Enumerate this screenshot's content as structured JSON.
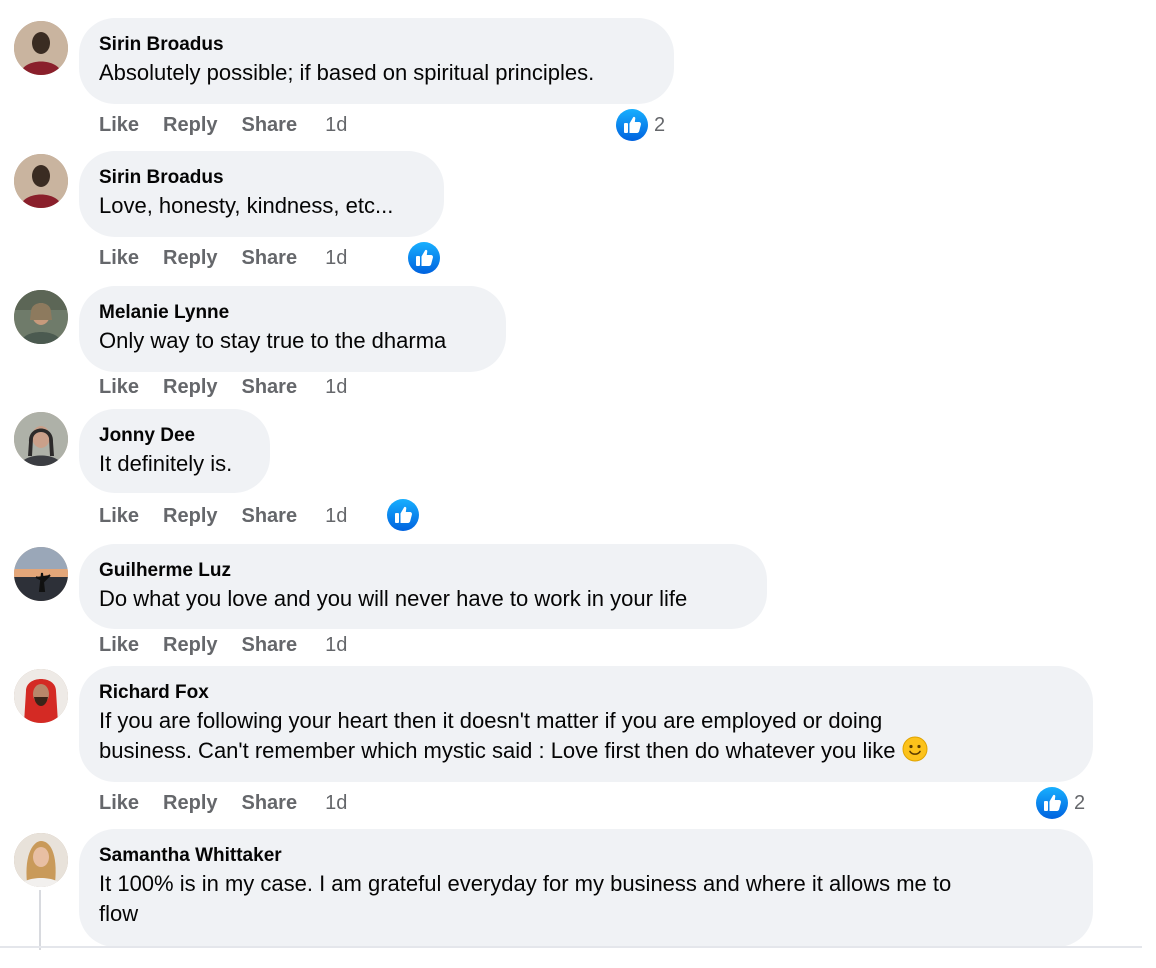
{
  "comments": [
    {
      "author": "Sirin Broadus",
      "text": "Absolutely possible; if based on spiritual principles.",
      "like": "Like",
      "reply": "Reply",
      "share": "Share",
      "time": "1d",
      "reaction_count": "2"
    },
    {
      "author": "Sirin Broadus",
      "text": "Love, honesty, kindness, etc...",
      "like": "Like",
      "reply": "Reply",
      "share": "Share",
      "time": "1d"
    },
    {
      "author": "Melanie Lynne",
      "text": "Only way to stay true to the dharma",
      "like": "Like",
      "reply": "Reply",
      "share": "Share",
      "time": "1d"
    },
    {
      "author": "Jonny Dee",
      "text": "It definitely is.",
      "like": "Like",
      "reply": "Reply",
      "share": "Share",
      "time": "1d"
    },
    {
      "author": "Guilherme Luz",
      "text": "Do what you love and you will never have to work in your life",
      "like": "Like",
      "reply": "Reply",
      "share": "Share",
      "time": "1d"
    },
    {
      "author": "Richard Fox",
      "text_line1": "If you are following your heart then it doesn't matter if you are employed or doing",
      "text_line2": "business. Can't remember which mystic said : Love first then do whatever you like",
      "like": "Like",
      "reply": "Reply",
      "share": "Share",
      "time": "1d",
      "reaction_count": "2"
    },
    {
      "author": "Samantha Whittaker",
      "text_line1": "It 100% is in my case. I am grateful everyday for my business and where it allows me to",
      "text_line2": "flow"
    }
  ],
  "colors": {
    "like_blue": "#1877f2",
    "bubble": "#f0f2f5",
    "meta": "#65676b"
  },
  "icons": {
    "reaction": "like-thumb-icon",
    "emoji": "slightly-smiling-face-icon"
  }
}
